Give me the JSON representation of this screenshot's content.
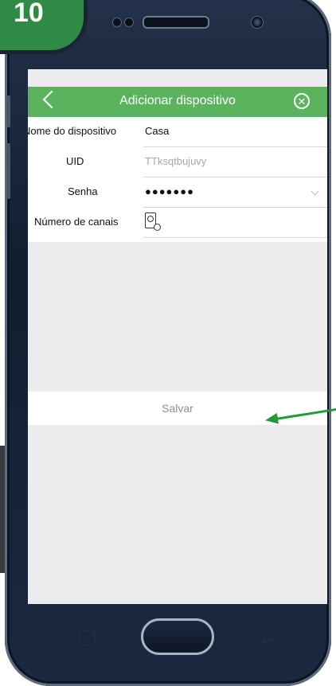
{
  "badge": {
    "step_number": "10"
  },
  "header": {
    "title": "Adicionar dispositivo",
    "back_icon": "chevron-left-icon",
    "close_icon": "close-circle-icon",
    "color": "#5cb35e"
  },
  "form": {
    "device_name": {
      "label": "Nome do dispositivo",
      "value": "Casa"
    },
    "uid": {
      "label": "UID",
      "placeholder": "TTksqtbujuvy"
    },
    "password": {
      "label": "Senha",
      "value": "●●●●●●●",
      "icon": "chevron-down-icon"
    },
    "channels": {
      "label": "Número de canais",
      "icon": "channel-device-icon"
    }
  },
  "save_label": "Salvar",
  "annotation": {
    "arrow_color": "#1f9a3c"
  }
}
